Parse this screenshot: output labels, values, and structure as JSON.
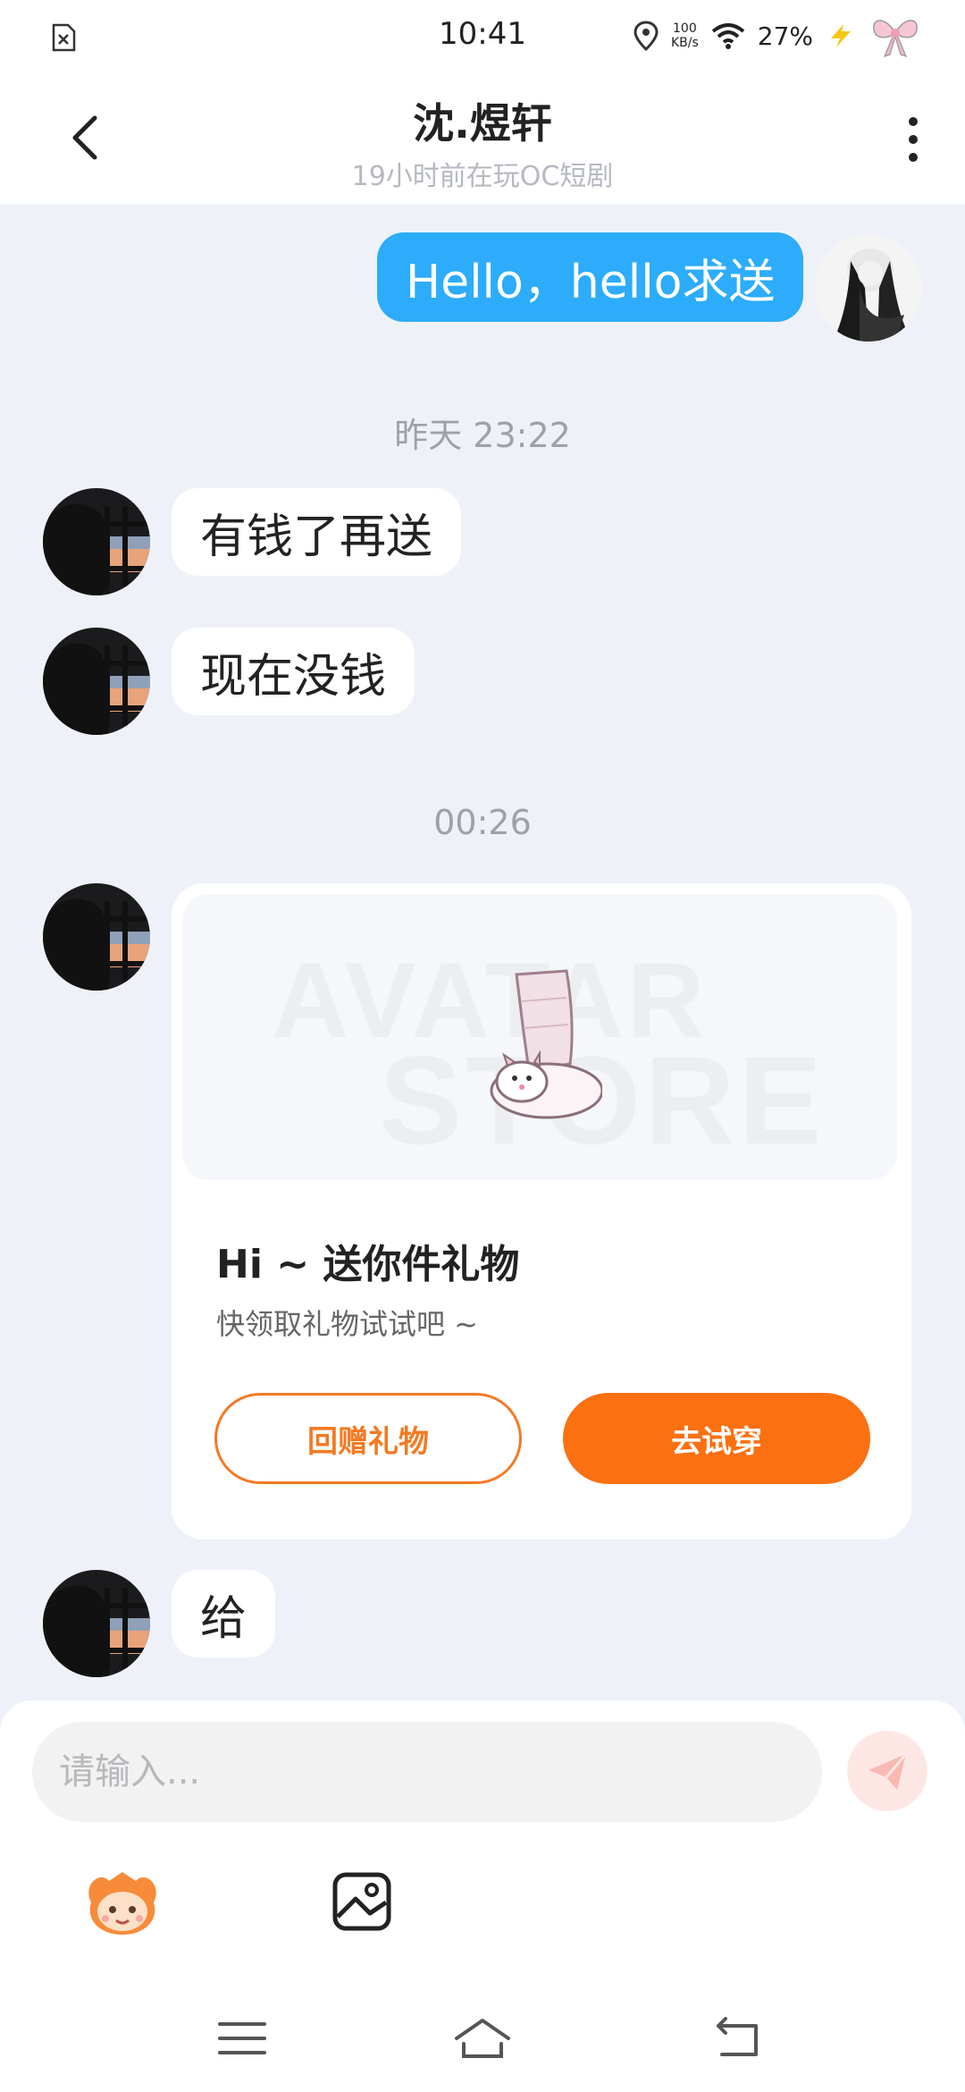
{
  "status_bar": {
    "time": "10:41",
    "speed_value": "100",
    "speed_unit": "KB/s",
    "battery": "27%"
  },
  "header": {
    "title": "沈.煜轩",
    "subtitle": "19小时前在玩OC短剧"
  },
  "messages": [
    {
      "from": "me",
      "text": "Hello，hello求送"
    },
    {
      "timestamp": "昨天 23:22"
    },
    {
      "from": "other",
      "text": "有钱了再送"
    },
    {
      "from": "other",
      "text": "现在没钱"
    },
    {
      "timestamp": "00:26"
    },
    {
      "from": "other",
      "text": "给"
    }
  ],
  "gift_card": {
    "watermark_line1": "AVATAR",
    "watermark_line2": "STORE",
    "title": "Hi ~ 送你件礼物",
    "description": "快领取礼物试试吧 ~",
    "return_label": "回赠礼物",
    "try_label": "去试穿"
  },
  "input": {
    "placeholder": "请输入..."
  },
  "colors": {
    "my_bubble": "#2cacfa",
    "accent_orange": "#fb7011",
    "background": "#eef2f8"
  },
  "icons": {
    "toolbar": [
      "avatar-mascot-icon",
      "image-icon"
    ],
    "navigation": [
      "menu-icon",
      "home-icon",
      "back-nav-icon"
    ]
  }
}
